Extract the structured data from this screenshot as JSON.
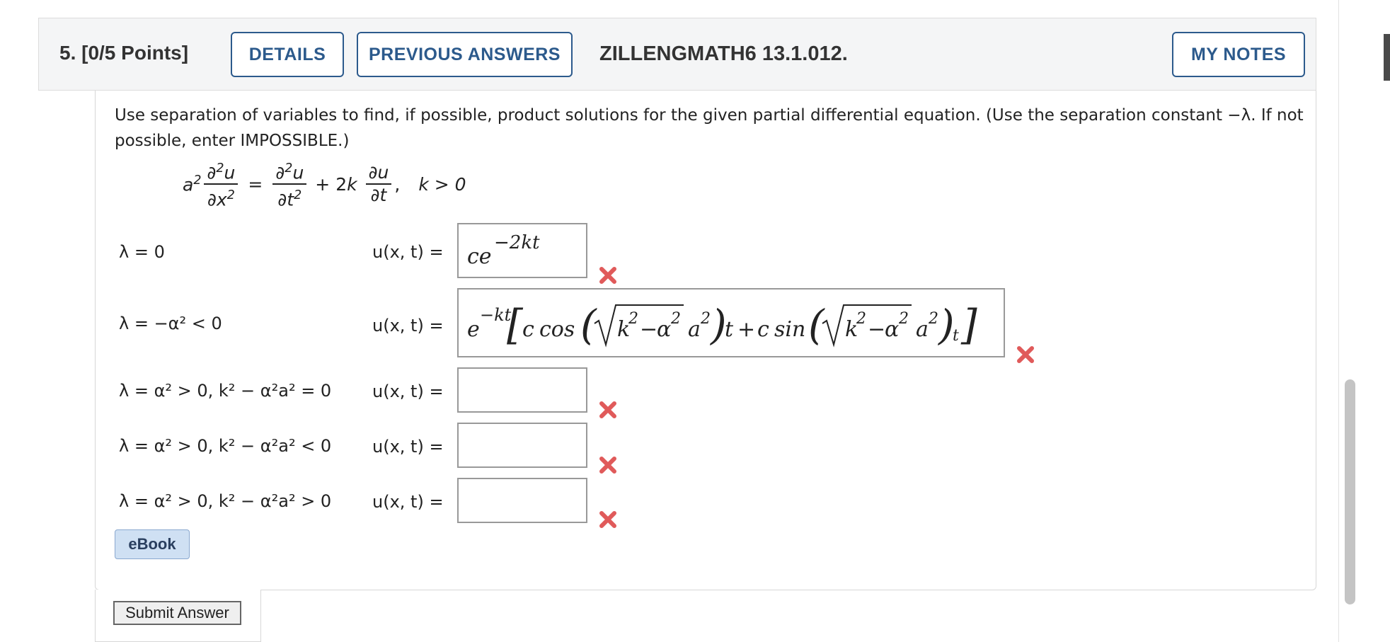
{
  "question": {
    "number_points": "5.  [0/5 Points]",
    "code": "ZILLENGMATH6 13.1.012."
  },
  "buttons": {
    "details": "DETAILS",
    "previous_answers": "PREVIOUS ANSWERS",
    "my_notes": "MY NOTES",
    "ebook": "eBook",
    "submit": "Submit Answer"
  },
  "instructions": "Use separation of variables to find, if possible, product solutions for the given partial differential equation. (Use the separation constant −λ. If not possible, enter IMPOSSIBLE.)",
  "equation": {
    "condition": "k > 0"
  },
  "cases": [
    {
      "condition": "λ = 0",
      "label": "u(x, t) =",
      "answer": "ce^{−2kt}",
      "correct": false
    },
    {
      "condition": "λ = −α² < 0",
      "label": "u(x, t) =",
      "answer": "e^{−kt}[c cos(√(k² − α² a²))t + c sin(√(k² − α² a²))t]",
      "correct": false
    },
    {
      "condition": "λ = α² > 0, k² − α²a² = 0",
      "label": "u(x, t) =",
      "answer": "",
      "correct": false
    },
    {
      "condition": "λ = α² > 0, k² − α²a² < 0",
      "label": "u(x, t) =",
      "answer": "",
      "correct": false
    },
    {
      "condition": "λ = α² > 0, k² − α²a² > 0",
      "label": "u(x, t) =",
      "answer": "",
      "correct": false
    }
  ],
  "colors": {
    "button_blue": "#2c5a8c",
    "error_red": "#e05a5a"
  }
}
